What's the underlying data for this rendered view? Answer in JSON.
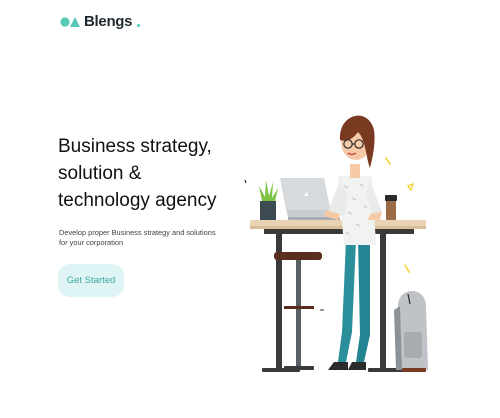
{
  "brand": {
    "name": "Blengs",
    "accent": "#58c9b9"
  },
  "hero": {
    "headline_lines": [
      "Business strategy,",
      "solution &",
      "technology agency"
    ],
    "subtext": "Develop proper Business strategy and solutions for your corporation",
    "cta_label": "Get Started"
  },
  "illustration": {
    "icon": "woman-at-standing-desk-illustration"
  },
  "colors": {
    "headline": "#111111",
    "cta_background": "#dff4f4",
    "cta_text": "#3aa9a0",
    "desk_top": "#e9d3b4",
    "desk_frame": "#3a3a3a",
    "pants": "#2a8f9a",
    "hair": "#7a3a22",
    "laptop": "#c9cdd2",
    "backpack": "#bfc3c8"
  }
}
